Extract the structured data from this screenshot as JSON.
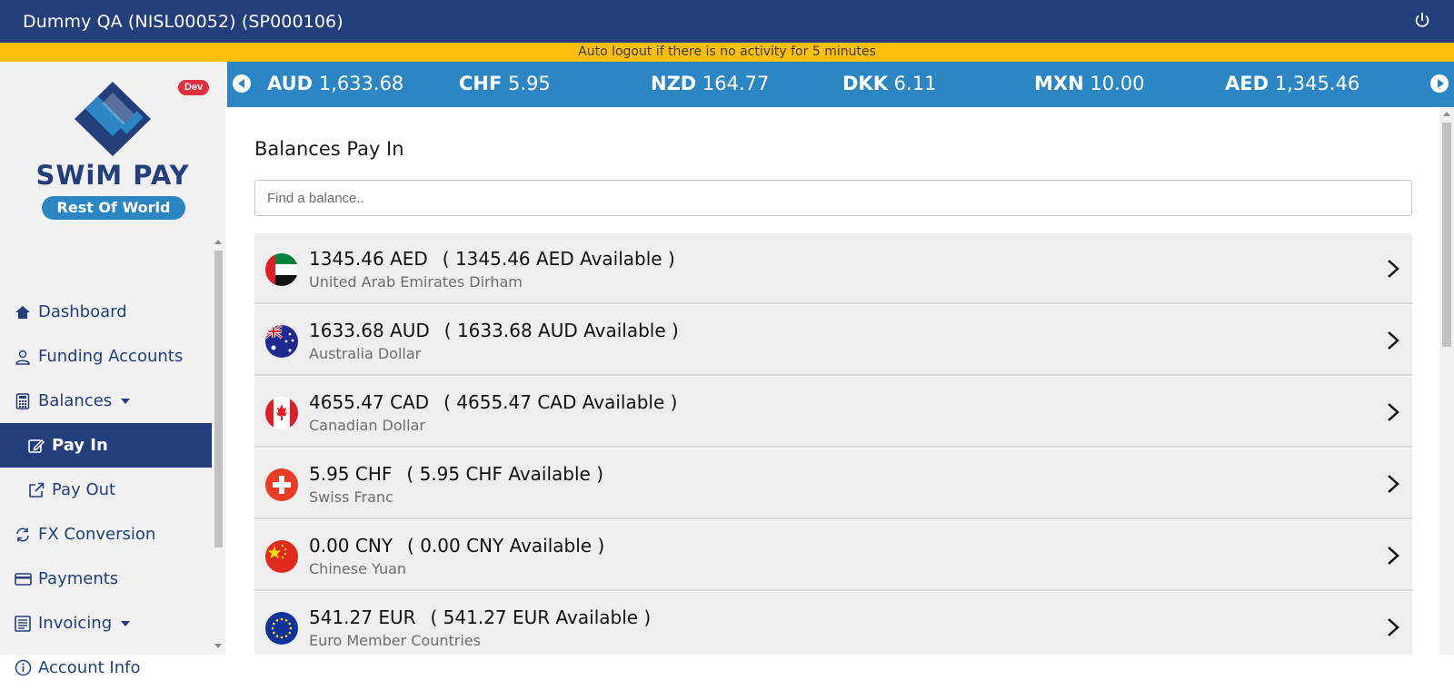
{
  "header": {
    "title": "Dummy QA (NISL00052) (SP000106)",
    "power_icon": "power-icon"
  },
  "notice": "Auto logout if there is no activity for 5 minutes",
  "sidebar": {
    "badge": "Dev",
    "brand": "SWiM PAY",
    "region": "Rest Of World",
    "items": [
      {
        "label": "Dashboard",
        "icon": "home-icon"
      },
      {
        "label": "Funding Accounts",
        "icon": "user-icon"
      },
      {
        "label": "Balances",
        "icon": "calculator-icon",
        "expandable": true
      },
      {
        "label": "Pay In",
        "icon": "edit-icon",
        "active": true,
        "sub": true
      },
      {
        "label": "Pay Out",
        "icon": "external-link-icon",
        "sub": true
      },
      {
        "label": "FX Conversion",
        "icon": "refresh-icon"
      },
      {
        "label": "Payments",
        "icon": "credit-card-icon"
      },
      {
        "label": "Invoicing",
        "icon": "list-icon",
        "expandable": true
      },
      {
        "label": "Account Info",
        "icon": "info-icon"
      }
    ]
  },
  "ticker": [
    {
      "code": "AUD",
      "value": "1,633.68"
    },
    {
      "code": "CHF",
      "value": "5.95"
    },
    {
      "code": "NZD",
      "value": "164.77"
    },
    {
      "code": "DKK",
      "value": "6.11"
    },
    {
      "code": "MXN",
      "value": "10.00"
    },
    {
      "code": "AED",
      "value": "1,345.46"
    }
  ],
  "main": {
    "title": "Balances Pay In",
    "search_placeholder": "Find a balance..",
    "balances": [
      {
        "amount": "1345.46 AED",
        "available": "( 1345.46 AED Available )",
        "name": "United Arab Emirates Dirham",
        "flag": "flag-uae-icon"
      },
      {
        "amount": "1633.68 AUD",
        "available": "( 1633.68 AUD Available )",
        "name": "Australia Dollar",
        "flag": "flag-australia-icon"
      },
      {
        "amount": "4655.47 CAD",
        "available": "( 4655.47 CAD Available )",
        "name": "Canadian Dollar",
        "flag": "flag-canada-icon"
      },
      {
        "amount": "5.95 CHF",
        "available": "( 5.95 CHF Available )",
        "name": "Swiss Franc",
        "flag": "flag-switzerland-icon"
      },
      {
        "amount": "0.00 CNY",
        "available": "( 0.00 CNY Available )",
        "name": "Chinese Yuan",
        "flag": "flag-china-icon"
      },
      {
        "amount": "541.27 EUR",
        "available": "( 541.27 EUR Available )",
        "name": "Euro Member Countries",
        "flag": "flag-eu-icon"
      }
    ]
  }
}
